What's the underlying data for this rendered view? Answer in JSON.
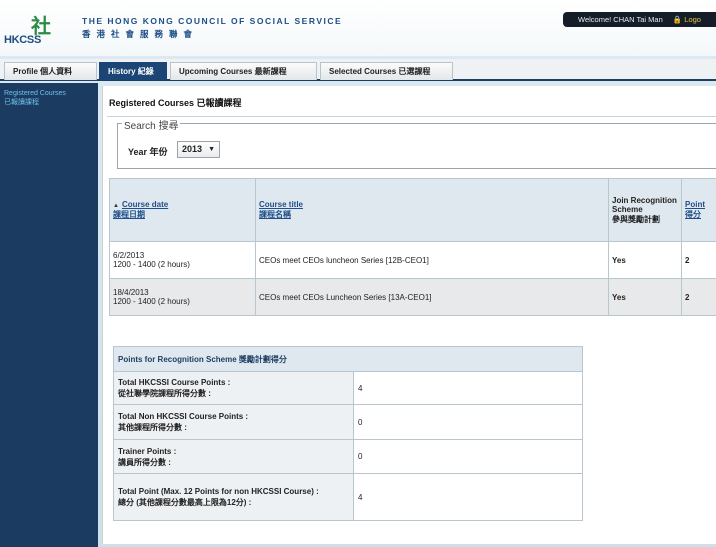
{
  "header": {
    "logo_mark": "社",
    "logo_text": "HKCSS",
    "org_name_en": "THE HONG KONG COUNCIL OF SOCIAL SERVICE",
    "org_name_zh": "香港社會服務聯會",
    "welcome": "Welcome! CHAN Tai Man",
    "logout": "Logo"
  },
  "tabs": [
    {
      "label": "Profile 個人資料"
    },
    {
      "label": "History 紀錄"
    },
    {
      "label": "Upcoming Courses 最新課程"
    },
    {
      "label": "Selected Courses 已選課程"
    }
  ],
  "sidebar": {
    "item_en": "Registered Courses",
    "item_zh": "已報讀課程"
  },
  "main": {
    "title": "Registered Courses 已報讀課程",
    "search_legend": "Search 搜尋",
    "year_label": "Year 年份",
    "year_value": "2013"
  },
  "courses_table": {
    "headers": {
      "date_en": "Course date",
      "date_zh": "課程日期",
      "title_en": "Course title",
      "title_zh": "課程名稱",
      "join_en": "Join Recognition Scheme",
      "join_zh": "參與獎勵計劃",
      "point_en": "Point",
      "point_zh": "得分"
    },
    "rows": [
      {
        "date": "6/2/2013",
        "time": "1200 - 1400 (2 hours)",
        "title": "CEOs meet CEOs luncheon Series [12B-CEO1]",
        "join": "Yes",
        "point": "2"
      },
      {
        "date": "18/4/2013",
        "time": "1200 - 1400 (2 hours)",
        "title": "CEOs meet CEOs Luncheon Series [13A-CEO1]",
        "join": "Yes",
        "point": "2"
      }
    ]
  },
  "points_table": {
    "header": "Points for Recognition Scheme 獎勵計劃得分",
    "rows": [
      {
        "label_en": "Total HKCSSI Course Points :",
        "label_zh": "從社聯學院課程所得分數 :",
        "value": "4"
      },
      {
        "label_en": "Total Non HKCSSI Course Points :",
        "label_zh": "其他課程所得分數 :",
        "value": "0"
      },
      {
        "label_en": "Trainer Points :",
        "label_zh": "講員所得分數 :",
        "value": "0"
      },
      {
        "label_en": "Total Point (Max. 12 Points for non HKCSSI Course) :",
        "label_zh": "總分 (其他課程分數最高上限為12分) :",
        "value": "4"
      }
    ]
  }
}
